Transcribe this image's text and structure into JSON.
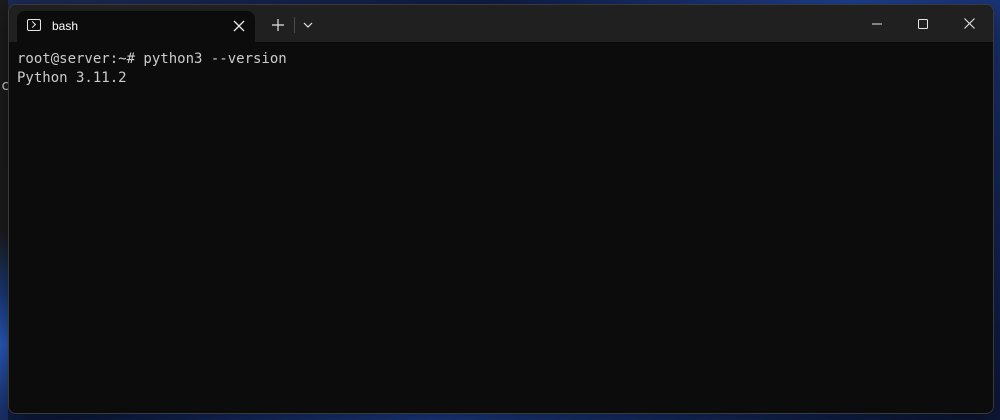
{
  "tab": {
    "title": "bash",
    "icon": "terminal-icon"
  },
  "toolbar": {
    "new_tab_icon": "plus-icon",
    "dropdown_icon": "chevron-down-icon"
  },
  "window_controls": {
    "minimize_icon": "minimize-icon",
    "maximize_icon": "maximize-icon",
    "close_icon": "close-icon"
  },
  "terminal": {
    "lines": [
      "root@server:~# python3 --version",
      "Python 3.11.2"
    ]
  },
  "background": {
    "partial_text": "c"
  },
  "colors": {
    "terminal_bg": "#0c0c0c",
    "titlebar_bg": "#202020",
    "text": "#cccccc"
  }
}
